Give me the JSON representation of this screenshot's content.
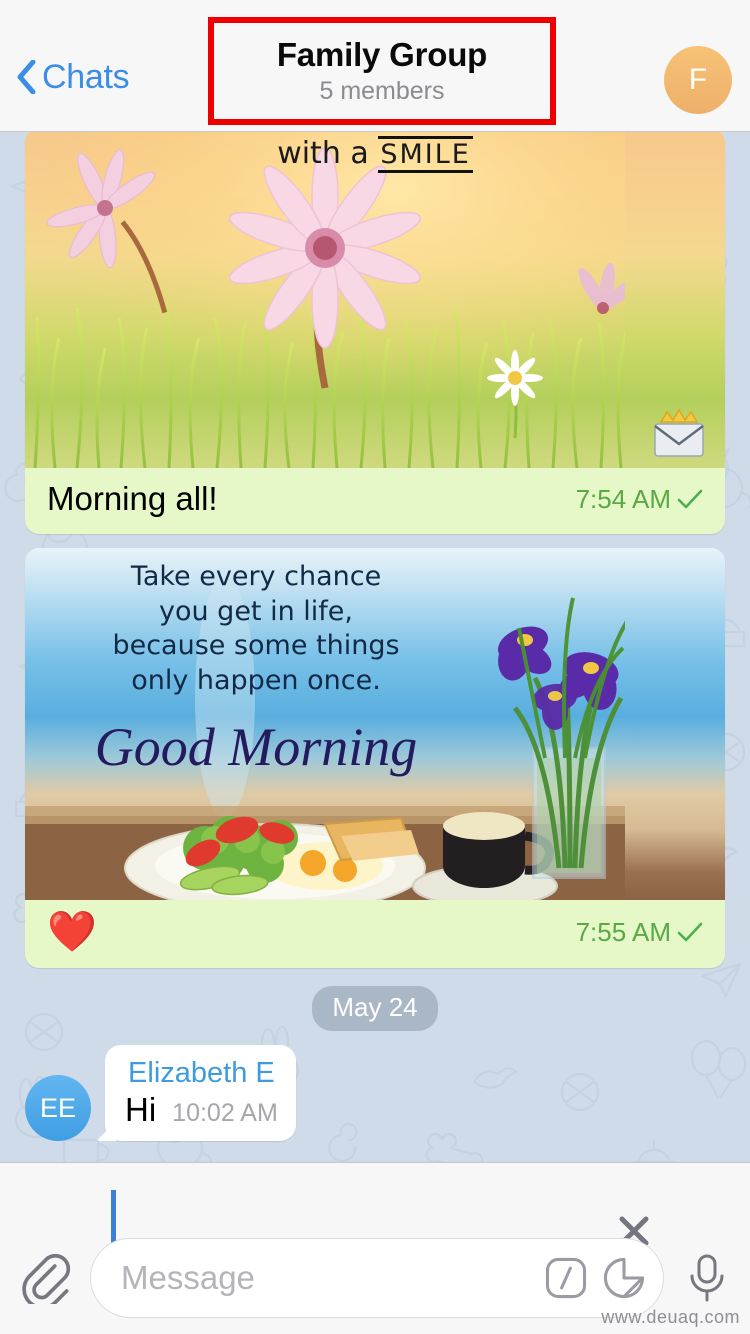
{
  "app": "Telegram",
  "header": {
    "back_label": "Chats",
    "back_icon": "chevron-left-icon",
    "title": "Family Group",
    "subtitle": "5 members",
    "avatar_initial": "F",
    "avatar_color": "#f2b96f",
    "highlight_color": "#ef0000",
    "accent_color": "#3b8ee6"
  },
  "messages": [
    {
      "id": "msg-photo-1",
      "direction": "outgoing",
      "type": "photo-with-caption",
      "photo_alt": "Pink flowers in sunlit grass good morning card",
      "photo_overlay_text_line1": "with a",
      "photo_overlay_text_line2": "SMILE",
      "caption": "Morning all!",
      "time": "7:54 AM",
      "status_icon": "single-check-icon",
      "bubble_color": "#e6f8c8",
      "time_color": "#5aa846"
    },
    {
      "id": "msg-photo-2",
      "direction": "outgoing",
      "type": "photo-with-caption",
      "photo_alt": "Breakfast by the sea with purple irises good morning card",
      "photo_quote_lines": [
        "Take every chance",
        "you get in life,",
        "because some things",
        "only happen once."
      ],
      "photo_headline": "Good Morning",
      "caption": "❤️",
      "time": "7:55 AM",
      "status_icon": "single-check-icon",
      "bubble_color": "#e6f8c8",
      "time_color": "#5aa846"
    }
  ],
  "date_divider": {
    "label": "May 24"
  },
  "incoming_message": {
    "id": "msg-hi",
    "avatar_initials": "EE",
    "avatar_color": "#4ba4e3",
    "sender": "Elizabeth E",
    "sender_color": "#3d9be0",
    "text": "Hi",
    "time": "10:02 AM"
  },
  "composer": {
    "clear_icon": "close-icon",
    "attach_icon": "paperclip-icon",
    "placeholder": "Message",
    "command_icon": "slash-command-icon",
    "sticker_icon": "sticker-icon",
    "mic_icon": "microphone-icon",
    "cursor_color": "#3b82d6"
  },
  "watermark": "www.deuaq.com"
}
